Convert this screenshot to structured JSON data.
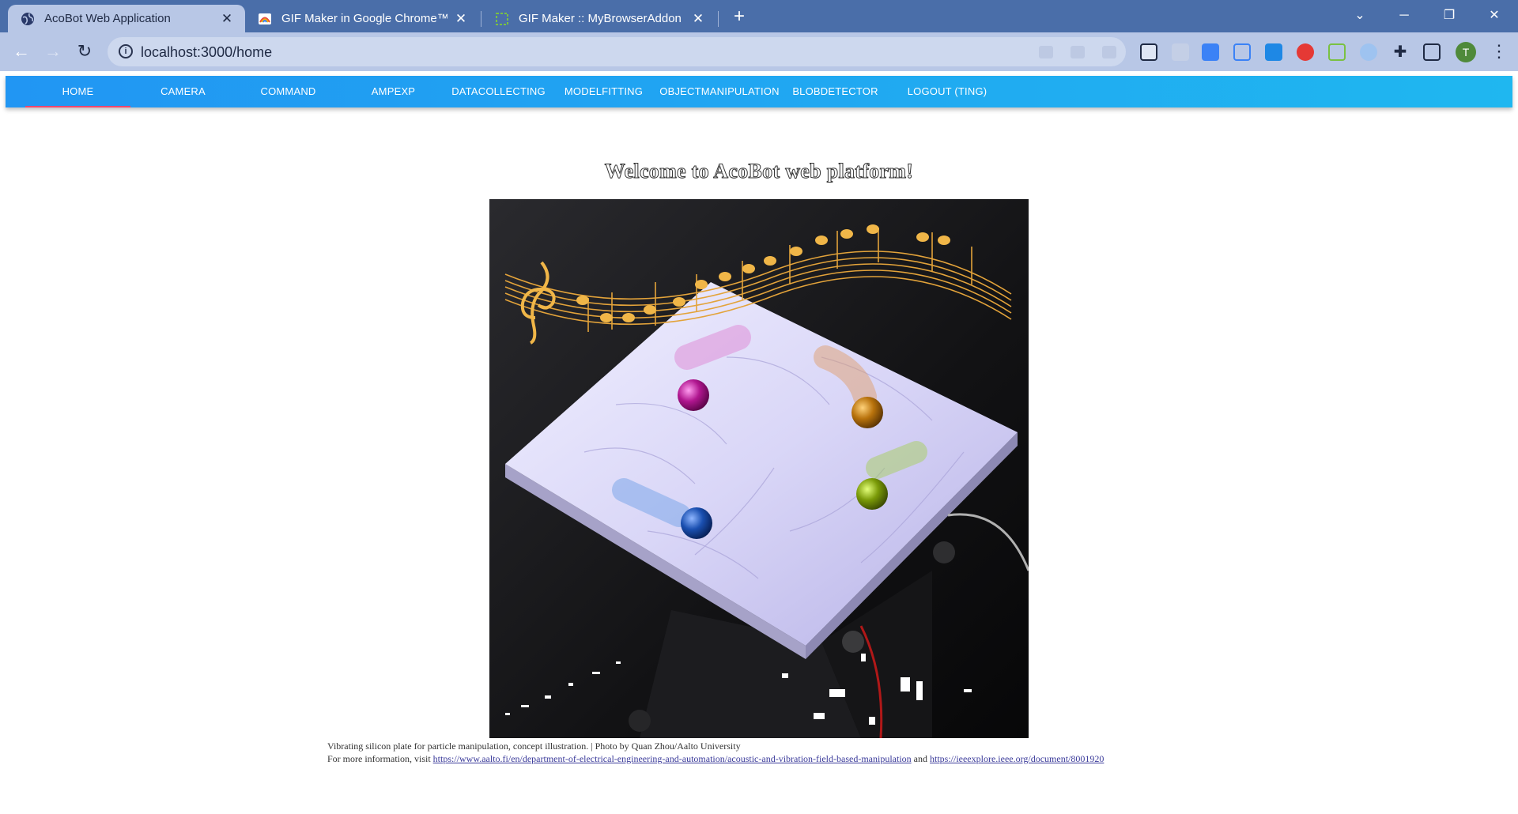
{
  "browser": {
    "tabs": [
      {
        "title": "AcoBot Web Application",
        "active": true,
        "icon": "globe-icon"
      },
      {
        "title": "GIF Maker in Google Chrome™ - ",
        "active": false,
        "icon": "gif-maker-icon"
      },
      {
        "title": "GIF Maker :: MyBrowserAddon",
        "active": false,
        "icon": "addon-icon"
      }
    ],
    "url": "localhost:3000/home",
    "profile_initial": "T"
  },
  "nav": {
    "items": [
      {
        "label": "HOME",
        "active": true
      },
      {
        "label": "CAMERA"
      },
      {
        "label": "COMMAND"
      },
      {
        "label": "AMPEXP"
      },
      {
        "label": "DATACOLLECTING"
      },
      {
        "label": "MODELFITTING"
      },
      {
        "label": "OBJECTMANIPULATION"
      },
      {
        "label": "BLOBDETECTOR"
      },
      {
        "label": "LOGOUT (TING)"
      }
    ]
  },
  "main": {
    "heading": "Welcome to AcoBot web platform!",
    "image_alt": "Vibrating silicon plate with music staff and colored balls",
    "caption_line1": "Vibrating silicon plate for particle manipulation, concept illustration. | Photo by Quan Zhou/Aalto University",
    "caption_line2_prefix": "For more information, visit",
    "link1": "https://www.aalto.fi/en/department-of-electrical-engineering-and-automation/acoustic-and-vibration-field-based-manipulation",
    "caption_and": "and",
    "link2": "https://ieeexplore.ieee.org/document/8001920"
  },
  "colors": {
    "nav_start": "#2196f3",
    "nav_end": "#1fb7f0",
    "active_indicator": "#f0466e",
    "tabstrip": "#4a6ea9",
    "toolbar": "#b8c7e6"
  }
}
